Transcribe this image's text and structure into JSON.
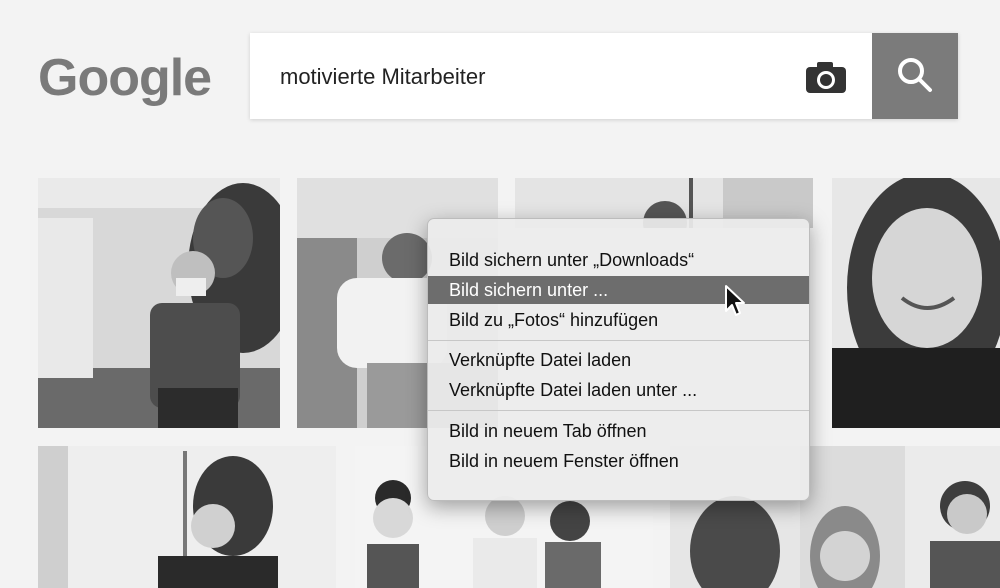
{
  "logo": {
    "text": "Google"
  },
  "search": {
    "query": "motivierte Mitarbeiter"
  },
  "icons": {
    "camera": "camera-icon",
    "search": "search-icon",
    "cursor": "mouse-pointer-icon"
  },
  "results": [
    {
      "name": "image-result-1"
    },
    {
      "name": "image-result-2"
    },
    {
      "name": "image-result-3"
    },
    {
      "name": "image-result-4"
    },
    {
      "name": "image-result-5"
    },
    {
      "name": "image-result-6"
    },
    {
      "name": "image-result-7"
    },
    {
      "name": "image-result-8"
    },
    {
      "name": "image-result-9"
    }
  ],
  "context_menu": {
    "items": [
      "Bild sichern unter „Downloads“",
      "Bild sichern unter ...",
      "Bild zu „Fotos“ hinzufügen",
      "Verknüpfte Datei laden",
      "Verknüpfte Datei laden unter ...",
      "Bild in neuem Tab öffnen",
      "Bild in neuem Fenster öffnen"
    ],
    "highlighted": 1
  },
  "colors": {
    "background": "#f3f3f3",
    "menu_highlight": "#6d6d6d",
    "search_button": "#7b7b7b"
  }
}
